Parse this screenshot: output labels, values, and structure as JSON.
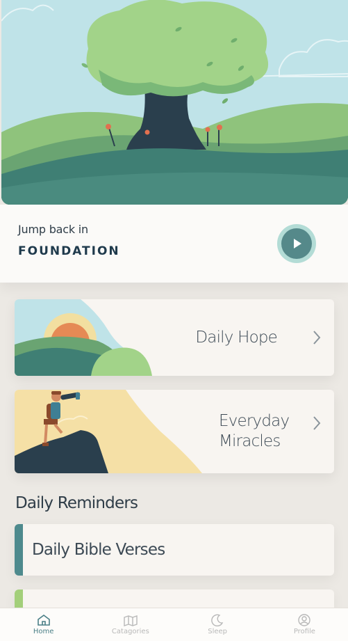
{
  "resume": {
    "subtitle": "Jump back in",
    "title": "FOUNDATION"
  },
  "cards": [
    {
      "label": "Daily Hope"
    },
    {
      "label_line1": "Everyday",
      "label_line2": "Miracles"
    }
  ],
  "reminders": {
    "section_title": "Daily Reminders",
    "items": [
      {
        "label": "Daily Bible Verses",
        "accent": "#4e8a8d"
      },
      {
        "label": "",
        "accent": "#a3cf7a"
      }
    ]
  },
  "tabs": [
    {
      "label": "Home",
      "icon": "home-icon",
      "active": true
    },
    {
      "label": "Catagories",
      "icon": "map-icon",
      "active": false
    },
    {
      "label": "Sleep",
      "icon": "moon-icon",
      "active": false
    },
    {
      "label": "Profile",
      "icon": "profile-icon",
      "active": false
    }
  ],
  "colors": {
    "accent": "#4a7f86",
    "inactive": "#b8b8b8",
    "play_ring": "#b3dcd6",
    "play_fill": "#55898a"
  }
}
